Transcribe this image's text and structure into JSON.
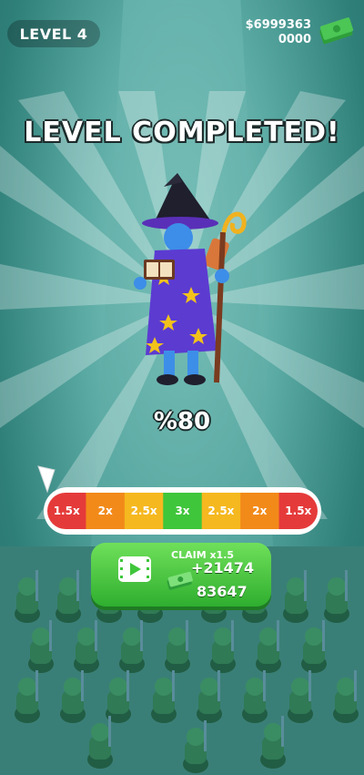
{
  "hud": {
    "level_label": "LEVEL 4",
    "cash_line1": "$6999363",
    "cash_line2": "0000",
    "cash_icon": "money-stack-icon"
  },
  "result": {
    "title": "LEVEL COMPLETED!",
    "percent": "%80",
    "character": "wizard-character"
  },
  "multiplier_meter": {
    "segments": [
      {
        "label": "1.5x",
        "color": "#e53a3a"
      },
      {
        "label": "2x",
        "color": "#f28a1a"
      },
      {
        "label": "2.5x",
        "color": "#f5b81f"
      },
      {
        "label": "3x",
        "color": "#3fc63b"
      },
      {
        "label": "2.5x",
        "color": "#f5b81f"
      },
      {
        "label": "2x",
        "color": "#f28a1a"
      },
      {
        "label": "1.5x",
        "color": "#e53a3a"
      }
    ],
    "pointer_icon": "triangle-pointer-icon"
  },
  "claim_button": {
    "label": "CLAIM x1.5",
    "bonus": "+21474",
    "total": "83647",
    "video_icon": "video-ad-icon",
    "money_icon": "money-stack-icon"
  },
  "colors": {
    "button_green": "#3fc63b",
    "sky_teal": "#5aa9a3"
  }
}
